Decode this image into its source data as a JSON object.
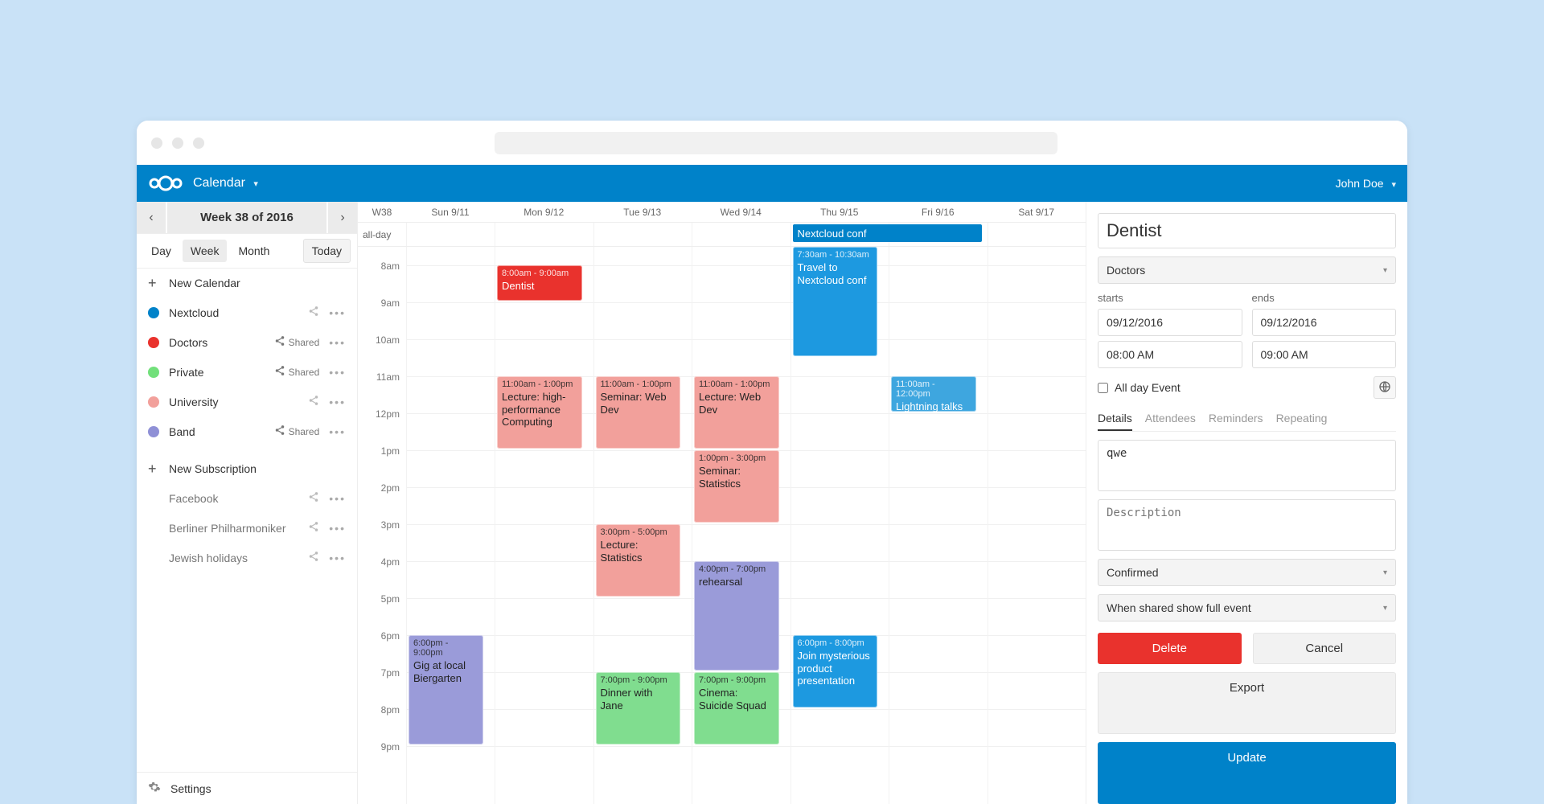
{
  "app": {
    "title": "Calendar",
    "user": "John Doe"
  },
  "weekbar": {
    "prev_aria": "Previous",
    "next_aria": "Next",
    "label": "Week 38 of 2016"
  },
  "views": {
    "day": "Day",
    "week": "Week",
    "month": "Month",
    "today": "Today"
  },
  "sidebar": {
    "new_calendar": "New Calendar",
    "new_subscription": "New Subscription",
    "shared_label": "Shared",
    "settings": "Settings",
    "calendars": [
      {
        "name": "Nextcloud",
        "color": "#0082c9",
        "shared": false
      },
      {
        "name": "Doctors",
        "color": "#e9322d",
        "shared": true
      },
      {
        "name": "Private",
        "color": "#72e07b",
        "shared": true
      },
      {
        "name": "University",
        "color": "#f2a09b",
        "shared": false
      },
      {
        "name": "Band",
        "color": "#8f90d6",
        "shared": true
      }
    ],
    "subscriptions": [
      {
        "name": "Facebook"
      },
      {
        "name": "Berliner Philharmoniker"
      },
      {
        "name": "Jewish holidays"
      }
    ]
  },
  "header": {
    "wk": "W38",
    "days": [
      "Sun 9/11",
      "Mon 9/12",
      "Tue 9/13",
      "Wed 9/14",
      "Thu 9/15",
      "Fri 9/16",
      "Sat 9/17"
    ],
    "allday_label": "all-day"
  },
  "hours": [
    "8am",
    "9am",
    "10am",
    "11am",
    "12pm",
    "1pm",
    "2pm",
    "3pm",
    "4pm",
    "5pm",
    "6pm",
    "7pm",
    "8pm",
    "9pm"
  ],
  "allday_events": [
    {
      "day": 5,
      "span": 2,
      "title": "Nextcloud conf",
      "color": "blue"
    }
  ],
  "events": [
    {
      "day": 2,
      "start": 8.0,
      "end": 9.0,
      "time": "8:00am - 9:00am",
      "title": "Dentist",
      "color": "red"
    },
    {
      "day": 5,
      "start": 7.5,
      "end": 10.5,
      "time": "7:30am - 10:30am",
      "title": "Travel to Nextcloud conf",
      "color": "blue"
    },
    {
      "day": 2,
      "start": 11.0,
      "end": 13.0,
      "time": "11:00am - 1:00pm",
      "title": "Lecture: high-performance Computing",
      "color": "salmon"
    },
    {
      "day": 3,
      "start": 11.0,
      "end": 13.0,
      "time": "11:00am - 1:00pm",
      "title": "Seminar: Web Dev",
      "color": "salmon"
    },
    {
      "day": 4,
      "start": 11.0,
      "end": 13.0,
      "time": "11:00am - 1:00pm",
      "title": "Lecture: Web Dev",
      "color": "salmon"
    },
    {
      "day": 6,
      "start": 11.0,
      "end": 12.0,
      "time": "11:00am - 12:00pm",
      "title": "Lightning talks",
      "color": "ltblue"
    },
    {
      "day": 4,
      "start": 13.0,
      "end": 15.0,
      "time": "1:00pm - 3:00pm",
      "title": "Seminar: Statistics",
      "color": "salmon"
    },
    {
      "day": 3,
      "start": 15.0,
      "end": 17.0,
      "time": "3:00pm - 5:00pm",
      "title": "Lecture: Statistics",
      "color": "salmon"
    },
    {
      "day": 4,
      "start": 16.0,
      "end": 19.0,
      "time": "4:00pm - 7:00pm",
      "title": "rehearsal",
      "color": "purple"
    },
    {
      "day": 1,
      "start": 18.0,
      "end": 21.0,
      "time": "6:00pm - 9:00pm",
      "title": "Gig at local Biergarten",
      "color": "purple"
    },
    {
      "day": 5,
      "start": 18.0,
      "end": 20.0,
      "time": "6:00pm - 8:00pm",
      "title": "Join mysterious product presentation",
      "color": "blue"
    },
    {
      "day": 3,
      "start": 19.0,
      "end": 21.0,
      "time": "7:00pm - 9:00pm",
      "title": "Dinner with Jane",
      "color": "green"
    },
    {
      "day": 4,
      "start": 19.0,
      "end": 21.0,
      "time": "7:00pm - 9:00pm",
      "title": "Cinema: Suicide Squad",
      "color": "green"
    }
  ],
  "details": {
    "title": "Dentist",
    "calendar": "Doctors",
    "starts_label": "starts",
    "ends_label": "ends",
    "start_date": "09/12/2016",
    "end_date": "09/12/2016",
    "start_time": "08:00 AM",
    "end_time": "09:00 AM",
    "allday_label": "All day Event",
    "tabs": {
      "details": "Details",
      "attendees": "Attendees",
      "reminders": "Reminders",
      "repeating": "Repeating"
    },
    "location": "qwe",
    "description_placeholder": "Description",
    "status": "Confirmed",
    "privacy": "When shared show full event",
    "delete": "Delete",
    "cancel": "Cancel",
    "export": "Export",
    "update": "Update"
  }
}
